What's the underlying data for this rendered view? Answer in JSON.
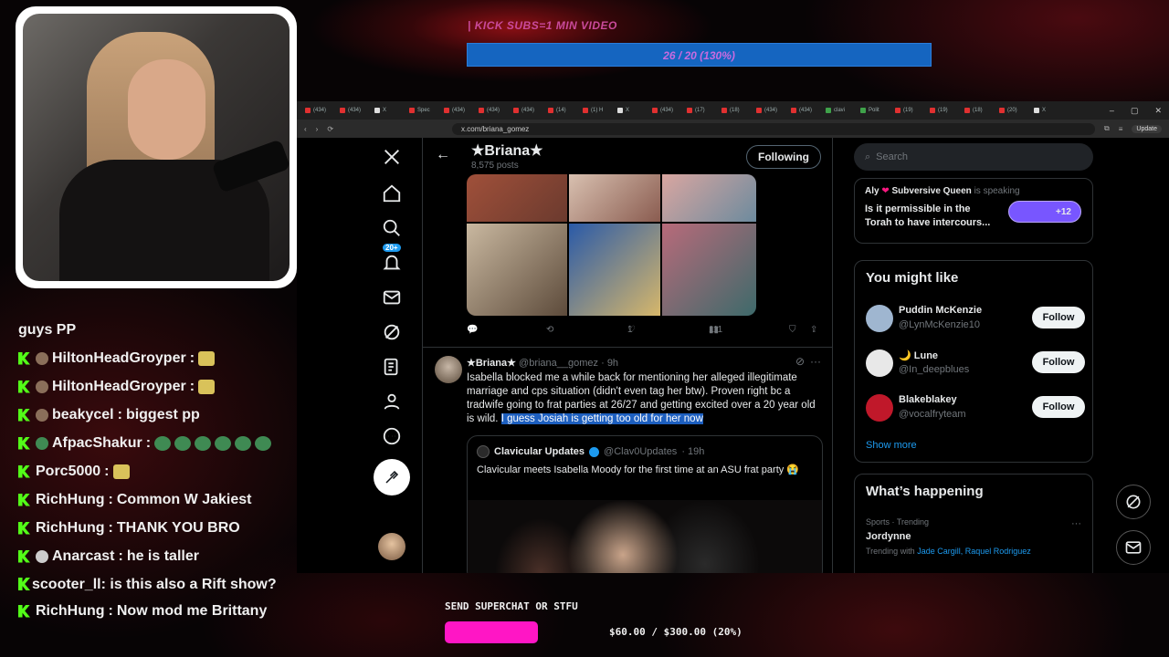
{
  "overlay": {
    "kick_label": "| KICK SUBS=1 MIN VIDEO",
    "kick_goal": "26 / 20 (130%)",
    "kick_goal_progress": 1.3,
    "superchat_label": "SEND SUPERCHAT OR STFU",
    "superchat_value": "$60.00 / $300.00 (20%)",
    "superchat_progress": 0.2,
    "accent_color": "#ff16c5"
  },
  "chat": [
    {
      "user": "",
      "text": "guys PP"
    },
    {
      "user": "HiltonHeadGroyper",
      "text": ""
    },
    {
      "user": "HiltonHeadGroyper",
      "text": ""
    },
    {
      "user": "beakycel",
      "text": "biggest pp"
    },
    {
      "user": "AfpacShakur",
      "text": ""
    },
    {
      "user": "Porc5000",
      "text": ""
    },
    {
      "user": "RichHung",
      "text": "Common W Jakiest"
    },
    {
      "user": "RichHung",
      "text": "THANK YOU BRO"
    },
    {
      "user": "Anarcast",
      "text": "he is taller"
    },
    {
      "user": "scooter_ll",
      "text": "is this also a Rift show?"
    },
    {
      "user": "RichHung",
      "text": "Now mod me Brittany"
    }
  ],
  "browser": {
    "url": "x.com/briana_gomez",
    "update_label": "Update",
    "tabs": [
      "(434)",
      "(434)",
      "X",
      "Spec",
      "(434)",
      "(434)",
      "(434)",
      "(14)",
      "(1) H",
      "X",
      "(434)",
      "(17)",
      "(18)",
      "(434)",
      "(434)",
      "clavi",
      "Polit",
      "(19)",
      "(19)",
      "(18)",
      "(20)",
      "X"
    ]
  },
  "profile": {
    "name": "★Briana★",
    "posts": "8,575 posts",
    "follow_state": "Following",
    "badge": "20+"
  },
  "media_post": {
    "replies": "",
    "reposts": "",
    "likes": "1",
    "views": "111"
  },
  "tweet": {
    "name": "★Briana★",
    "handle": "@briana__gomez",
    "time": "· 9h",
    "text_before": "Isabella blocked me a while back for mentioning her alleged illegitimate marriage and cps situation (didn't even tag her btw). Proven right bc a tradwife going to frat parties at 26/27 and getting excited over a 20 year old is wild. ",
    "text_highlight": "I guess Josiah is getting too old for her now"
  },
  "quote": {
    "name": "Clavicular Updates",
    "handle": "@Clav0Updates",
    "time": "· 19h",
    "text": "Clavicular meets Isabella Moody for the first time at an ASU frat party 😭"
  },
  "sidebar": {
    "search_placeholder": "Search",
    "space_host": "Aly",
    "space_host2": "Subversive Queen",
    "space_status": "is speaking",
    "space_title": "Is it permissible in the Torah to have intercours...",
    "space_count": "+12",
    "you_might_like": "You might like",
    "follow_label": "Follow",
    "users": [
      {
        "name": "Puddin McKenzie",
        "handle": "@LynMcKenzie10",
        "color": "#9fb6d0"
      },
      {
        "name": "🌙 Lune",
        "handle": "@In_deepblues",
        "color": "#e8e8e8"
      },
      {
        "name": "Blakeblakey",
        "handle": "@vocalfryteam",
        "color": "#c0182a"
      }
    ],
    "show_more": "Show more",
    "whats_happening": "What’s happening",
    "trend_category": "Sports · Trending",
    "trend_name": "Jordynne",
    "trend_with": "Trending with",
    "trend_links": "Jade Cargill, Raquel Rodriguez"
  }
}
